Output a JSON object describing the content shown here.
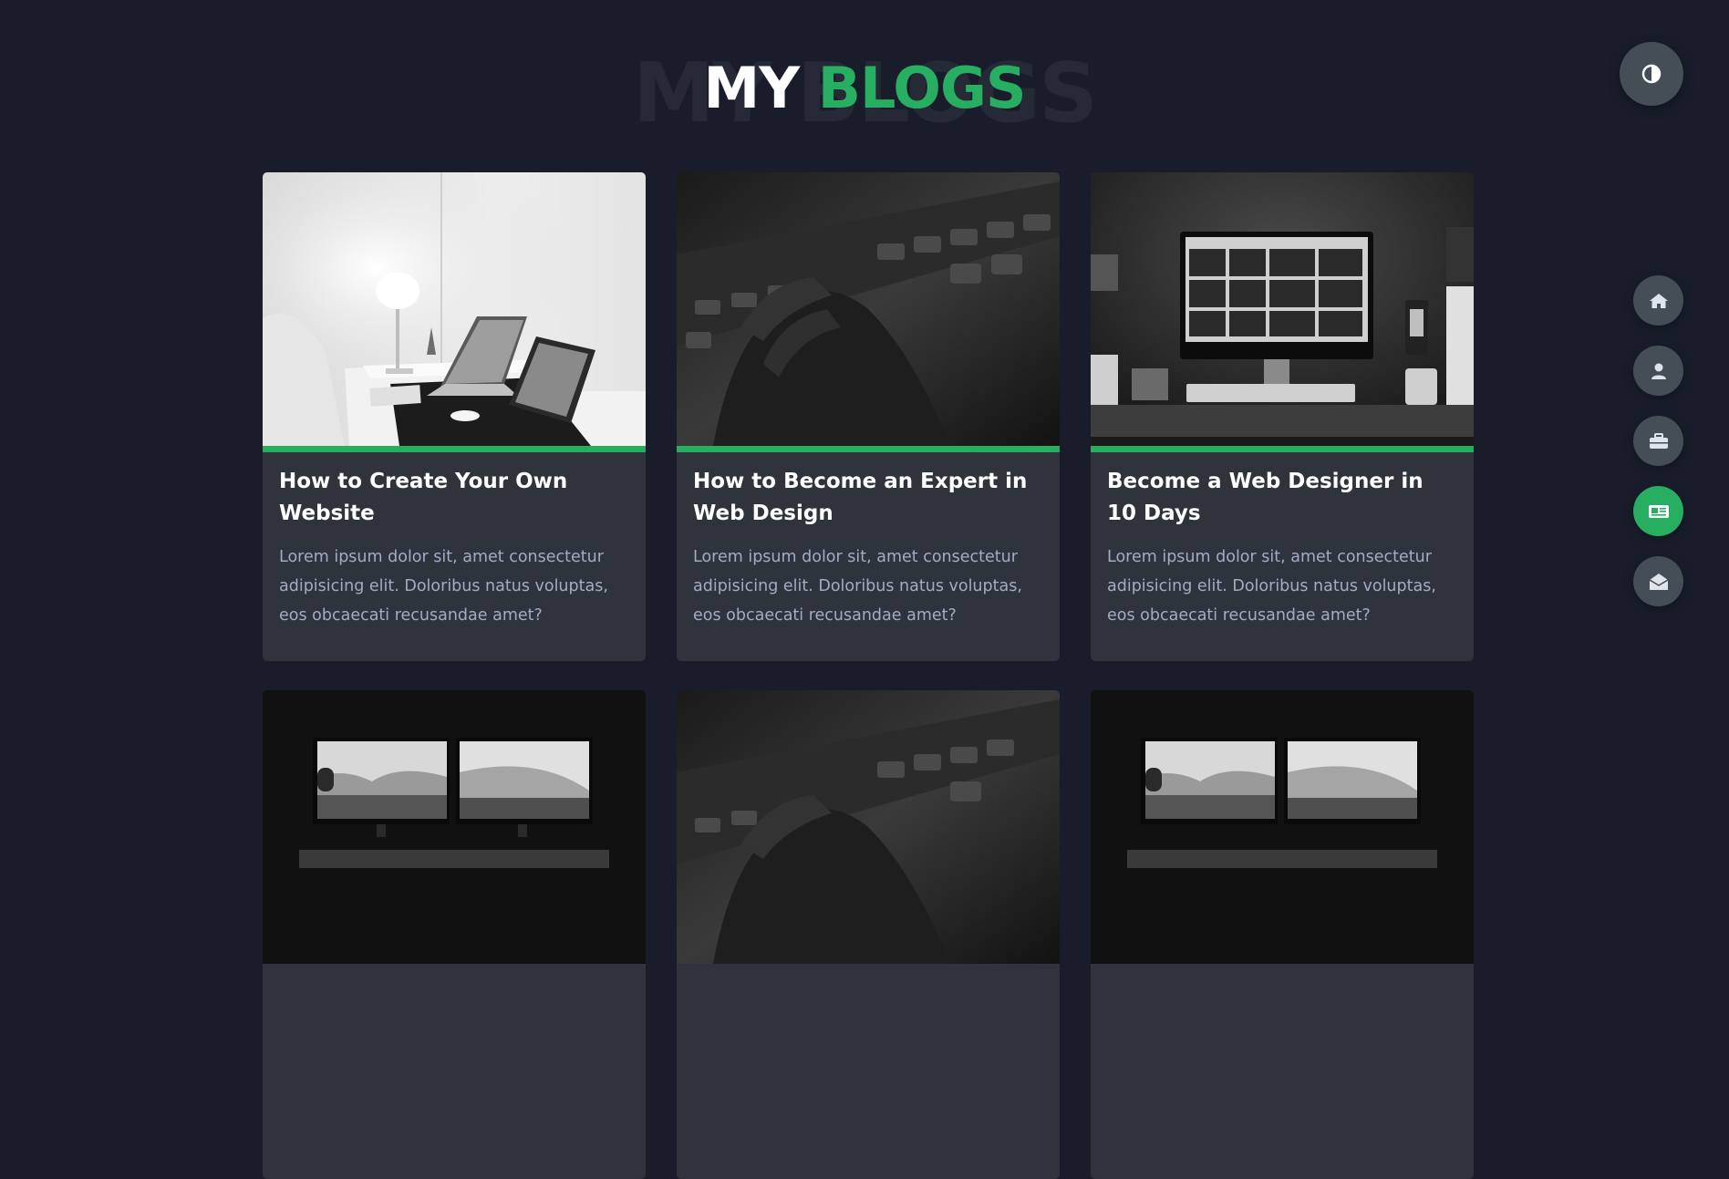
{
  "header": {
    "title_bg": "MY BLOGS",
    "title_white": "MY",
    "title_green": "BLOGS"
  },
  "theme_toggle": {
    "icon": "contrast-icon"
  },
  "nav": {
    "items": [
      {
        "icon": "home-icon",
        "active": false
      },
      {
        "icon": "user-icon",
        "active": false
      },
      {
        "icon": "briefcase-icon",
        "active": false
      },
      {
        "icon": "newspaper-icon",
        "active": true
      },
      {
        "icon": "envelope-open-icon",
        "active": false
      }
    ]
  },
  "blogs": [
    {
      "title": "How to Create Your Own Website",
      "excerpt": "Lorem ipsum dolor sit, amet consectetur adipisicing elit. Doloribus natus voluptas, eos obcaecati recusandae amet?"
    },
    {
      "title": "How to Become an Expert in Web Design",
      "excerpt": "Lorem ipsum dolor sit, amet consectetur adipisicing elit. Doloribus natus voluptas, eos obcaecati recusandae amet?"
    },
    {
      "title": "Become a Web Designer in 10 Days",
      "excerpt": "Lorem ipsum dolor sit, amet consectetur adipisicing elit. Doloribus natus voluptas, eos obcaecati recusandae amet?"
    },
    {
      "title": "",
      "excerpt": ""
    },
    {
      "title": "",
      "excerpt": ""
    },
    {
      "title": "",
      "excerpt": ""
    }
  ],
  "colors": {
    "background": "#191d2b",
    "card": "#2e333c",
    "accent": "#27ae60",
    "button": "#454e56"
  }
}
